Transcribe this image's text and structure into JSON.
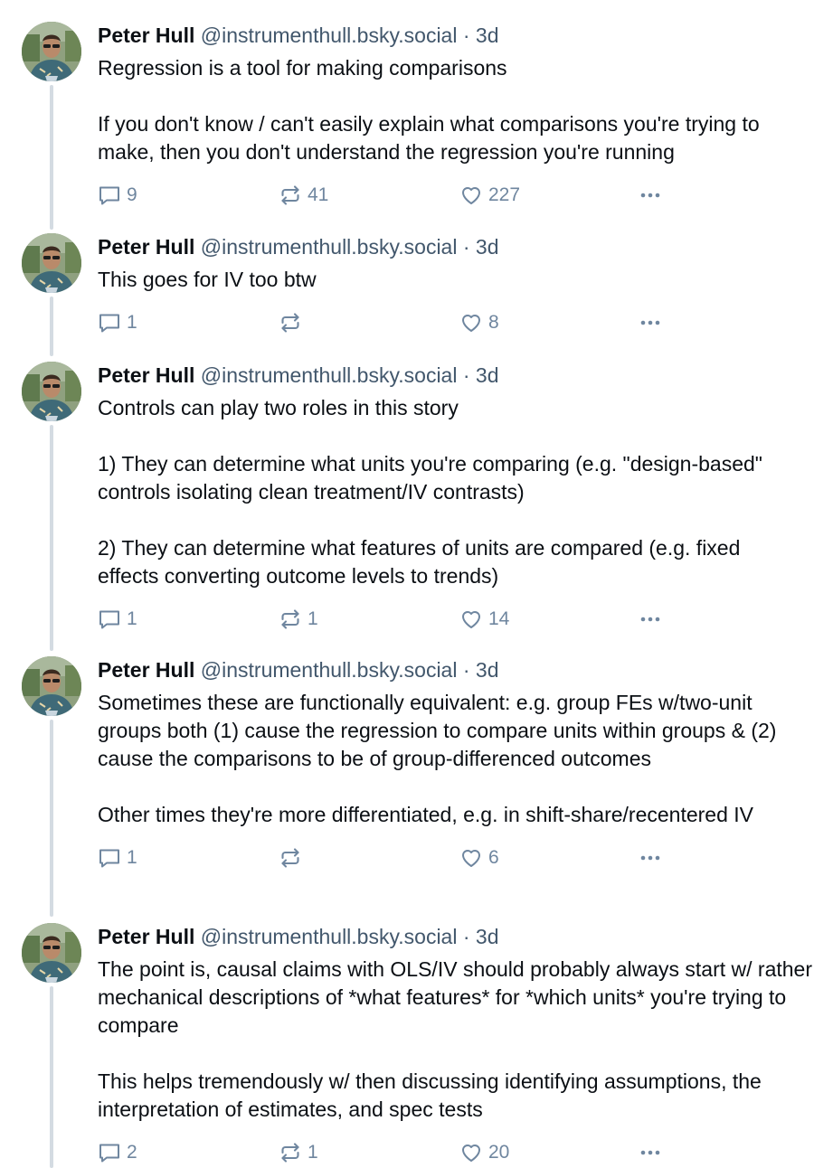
{
  "posts": [
    {
      "author": "Peter Hull",
      "handle": "@instrumenthull.bsky.social",
      "separator": "·",
      "time": "3d",
      "paragraphs": [
        "Regression is a tool for making comparisons",
        "If you don't know / can't easily explain what comparisons you're trying to make, then you don't understand the regression you're running"
      ],
      "replies": "9",
      "reposts": "41",
      "likes": "227"
    },
    {
      "author": "Peter Hull",
      "handle": "@instrumenthull.bsky.social",
      "separator": "·",
      "time": "3d",
      "paragraphs": [
        "This goes for IV too btw"
      ],
      "replies": "1",
      "reposts": "",
      "likes": "8"
    },
    {
      "author": "Peter Hull",
      "handle": "@instrumenthull.bsky.social",
      "separator": "·",
      "time": "3d",
      "paragraphs": [
        "Controls can play two roles in this story",
        "1) They can determine what units you're comparing (e.g. \"design-based\" controls isolating clean treatment/IV contrasts)",
        "2) They can determine what features of units are compared (e.g. fixed effects converting outcome levels to trends)"
      ],
      "replies": "1",
      "reposts": "1",
      "likes": "14"
    },
    {
      "author": "Peter Hull",
      "handle": "@instrumenthull.bsky.social",
      "separator": "·",
      "time": "3d",
      "paragraphs": [
        "Sometimes these are functionally equivalent: e.g. group FEs w/two-unit groups both (1) cause the regression to compare units within groups & (2) cause the comparisons to be of group-differenced outcomes",
        "Other times they're more differentiated, e.g. in shift-share/recentered IV"
      ],
      "replies": "1",
      "reposts": "",
      "likes": "6"
    },
    {
      "author": "Peter Hull",
      "handle": "@instrumenthull.bsky.social",
      "separator": "·",
      "time": "3d",
      "paragraphs": [
        "The point is, causal claims with OLS/IV should probably always start w/ rather mechanical descriptions of *what features* for *which units* you're trying to compare",
        "This helps tremendously w/ then discussing identifying assumptions, the interpretation of estimates, and spec tests"
      ],
      "replies": "2",
      "reposts": "1",
      "likes": "20"
    }
  ],
  "icons": {
    "reply": "reply-bubble-icon",
    "repost": "repost-arrows-icon",
    "like": "heart-icon",
    "more": "ellipsis-icon"
  },
  "colors": {
    "text": "#0b0f14",
    "secondary": "#42576c",
    "action": "#6f869f",
    "thread_line": "#d4dbe2"
  }
}
